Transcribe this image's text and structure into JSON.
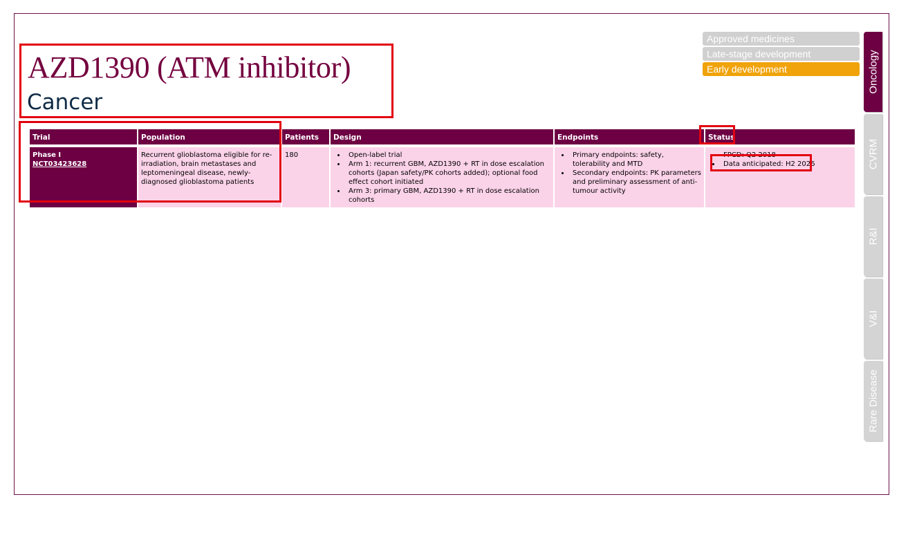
{
  "header": {
    "title": "AZD1390 (ATM inhibitor)",
    "subtitle": "Cancer"
  },
  "phase_legend": [
    {
      "label": "Approved medicines",
      "color": "#d0d0d0"
    },
    {
      "label": "Late-stage development",
      "color": "#d0d0d0"
    },
    {
      "label": "Early development",
      "color": "#f0a30a"
    }
  ],
  "side_tabs": [
    "Oncology",
    "CVRM",
    "R&I",
    "V&I",
    "Rare Disease"
  ],
  "table": {
    "headers": [
      "Trial",
      "Population",
      "Patients",
      "Design",
      "Endpoints",
      "Status"
    ],
    "rows": [
      {
        "trial_phase": "Phase I",
        "trial_id": "NCT03423628",
        "population": "Recurrent glioblastoma eligible for re-irradiation, brain metastases and leptomeningeal disease, newly-diagnosed glioblastoma patients",
        "patients": "180",
        "design": [
          "Open-label trial",
          "Arm 1: recurrent GBM, AZD1390 + RT in dose escalation cohorts (Japan safety/PK cohorts added); optional food effect cohort initiated",
          "Arm 3: primary GBM, AZD1390 + RT in dose escalation cohorts"
        ],
        "endpoints": [
          "Primary endpoints: safety, tolerability and MTD",
          "Secondary endpoints: PK parameters and preliminary assessment of anti-tumour activity"
        ],
        "status": [
          "FPCD: Q2 2018",
          "Data anticipated: H2 2026"
        ]
      }
    ]
  }
}
